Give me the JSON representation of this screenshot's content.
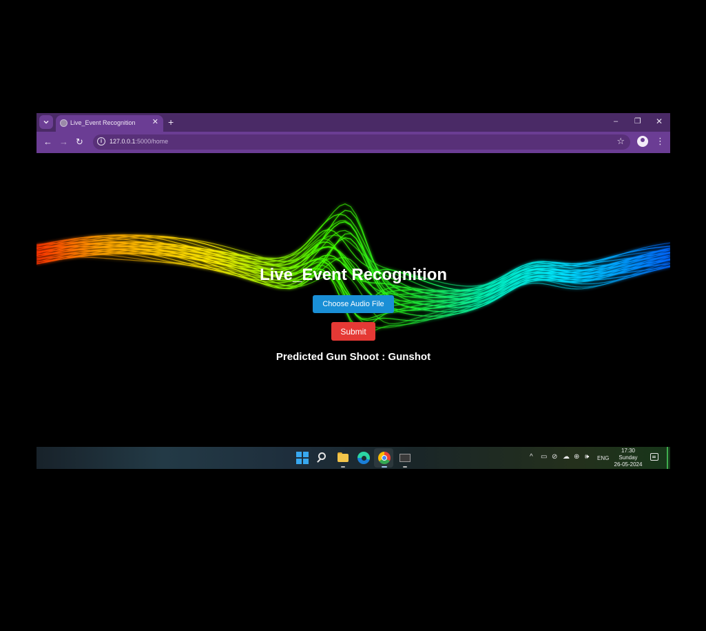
{
  "browser": {
    "tab_title": "Live_Event Recognition",
    "tab_close": "✕",
    "new_tab": "+",
    "window_controls": {
      "minimize": "–",
      "restore": "❐",
      "close": "✕"
    },
    "nav": {
      "back": "←",
      "forward": "→",
      "reload": "↻"
    },
    "url_host": "127.0.0.1",
    "url_path": ":5000/home",
    "bookmark_star": "☆",
    "menu": "⋮",
    "theme_color": "#6b3d94"
  },
  "page": {
    "title": "Live_Event Recognition",
    "choose_button_label": "Choose Audio File",
    "submit_button_label": "Submit",
    "prediction_text": "Predicted Gun Shoot : Gunshot",
    "choose_button_color": "#1a8fd6",
    "submit_button_color": "#e53935"
  },
  "taskbar": {
    "apps": [
      "start-icon",
      "search-icon",
      "file-explorer-icon",
      "edge-icon",
      "chrome-icon",
      "terminal-icon"
    ],
    "tray": {
      "chevron": "^",
      "battery": "▭",
      "camera": "⊘",
      "cloud": "☁",
      "globe": "⊕",
      "volume": "🕪",
      "language": "ENG"
    },
    "time": "17:30",
    "day": "Sunday",
    "date": "26-05-2024"
  }
}
